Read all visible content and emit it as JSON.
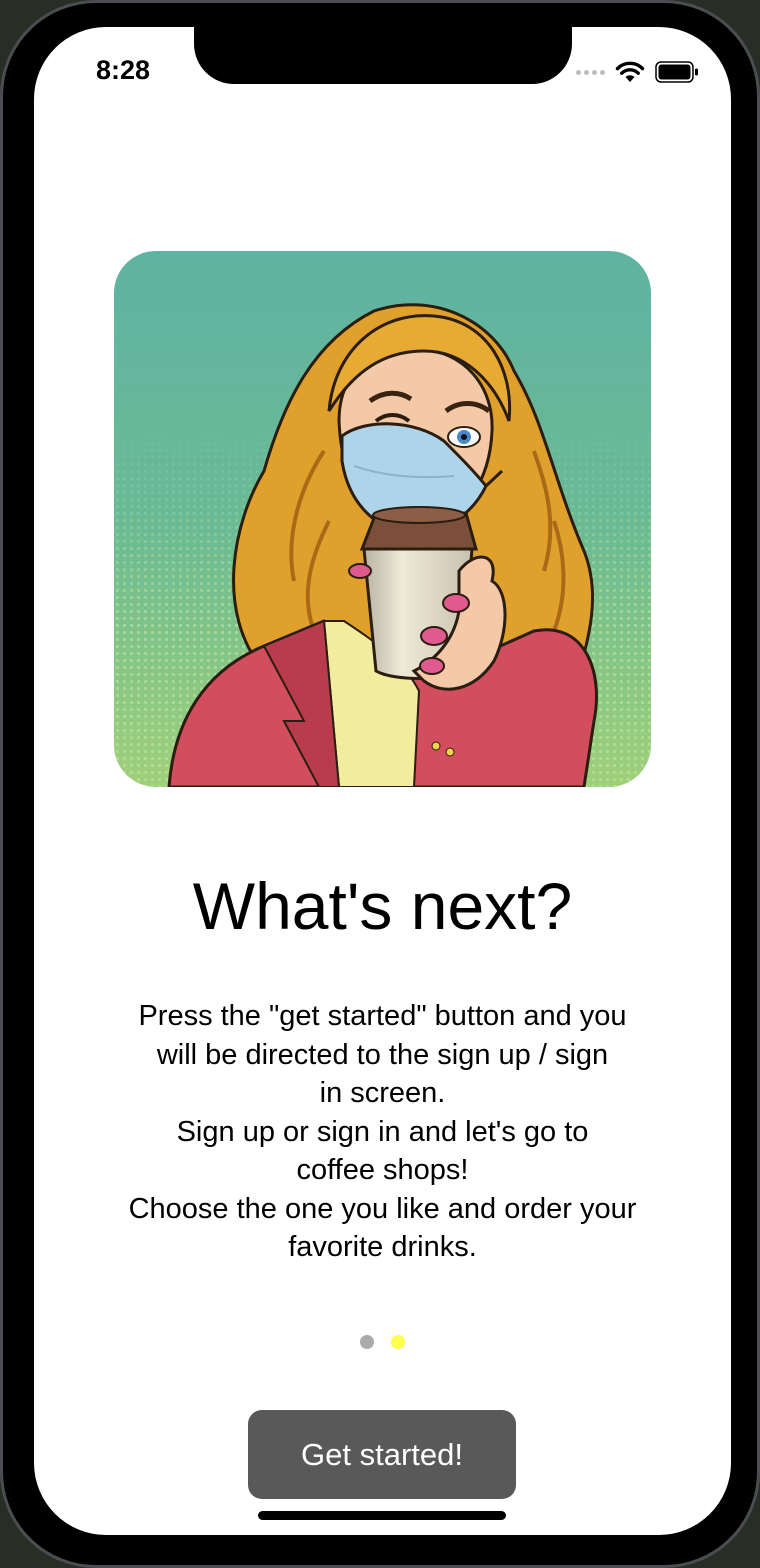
{
  "status_bar": {
    "time": "8:28",
    "icons": [
      "cellular-dots-icon",
      "wifi-icon",
      "battery-icon"
    ]
  },
  "onboarding": {
    "hero_image": "woman-with-mask-holding-coffee-illustration",
    "title": "What's next?",
    "description": "Press the \"get started\" button and you\nwill be directed to the sign up / sign\nin screen.\nSign up or sign in and let's go to\ncoffee shops!\nChoose the one you like and order your\nfavorite drinks.",
    "page_indicator": {
      "total": 2,
      "current": 2,
      "inactive_color": "#ababab",
      "active_color": "#ffff4d"
    },
    "cta_label": "Get started!",
    "cta_color": "#595959"
  }
}
